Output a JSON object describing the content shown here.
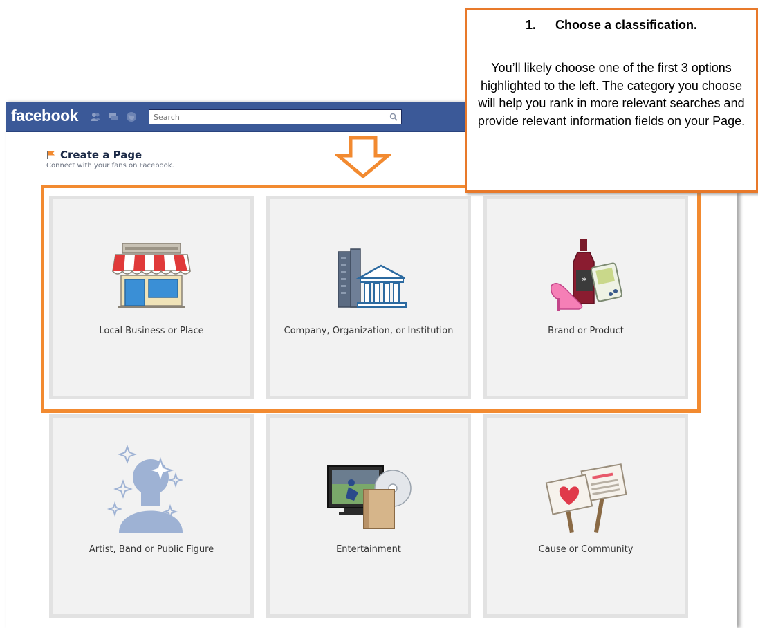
{
  "header": {
    "logo": "facebook",
    "search_placeholder": "Search",
    "icons": [
      "friends-icon",
      "messages-icon",
      "notifications-globe-icon",
      "search-icon"
    ]
  },
  "page": {
    "title": "Create a Page",
    "subtitle": "Connect with your fans on Facebook."
  },
  "categories": [
    {
      "label": "Local Business or Place",
      "icon": "storefront-icon"
    },
    {
      "label": "Company, Organization, or Institution",
      "icon": "buildings-icon"
    },
    {
      "label": "Brand or Product",
      "icon": "products-icon"
    },
    {
      "label": "Artist, Band or Public Figure",
      "icon": "public-figure-icon"
    },
    {
      "label": "Entertainment",
      "icon": "entertainment-icon"
    },
    {
      "label": "Cause or Community",
      "icon": "protest-signs-icon"
    }
  ],
  "callout": {
    "number": "1.",
    "heading": "Choose a classification.",
    "body": "You’ll likely choose one of the first 3 options highlighted to the left. The category you choose will help you rank in more relevant searches and provide relevant information fields on your Page."
  },
  "colors": {
    "facebook_blue": "#3b5998",
    "annotation_orange": "#f28a30",
    "tile_bg": "#f2f2f2",
    "tile_border": "#e2e2e2"
  }
}
